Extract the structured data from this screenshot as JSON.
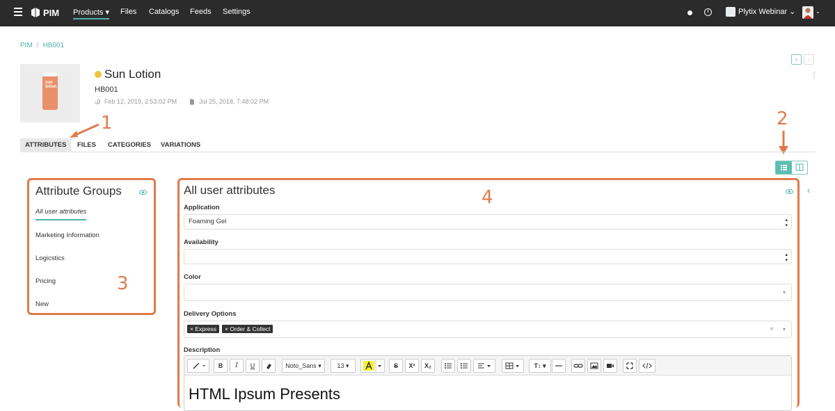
{
  "topbar": {
    "app_name": "PIM",
    "nav": [
      "Products",
      "Files",
      "Catalogs",
      "Feeds",
      "Settings"
    ],
    "products_caret": "▾",
    "account": "Plytix Webinar",
    "account_caret": "⌄",
    "avatar_caret": "⌄"
  },
  "breadcrumb": {
    "root": "PIM",
    "sep": "/",
    "current": "HB001"
  },
  "pager": {
    "prev": "‹",
    "next": "›"
  },
  "product": {
    "name": "Sun Lotion",
    "sku": "HB001",
    "modified": "Feb 12, 2019, 2:53:02 PM",
    "created": "Jul 25, 2018, 7:48:02 PM",
    "status_color": "#f3c13a",
    "image_label": "sun lotion"
  },
  "annotations": {
    "a1": "1",
    "a2": "2",
    "a3": "3",
    "a4": "4"
  },
  "tabs": [
    "ATTRIBUTES",
    "FILES",
    "CATEGORIES",
    "VARIATIONS"
  ],
  "groups": {
    "title": "Attribute Groups",
    "items": [
      "All user attributes",
      "Marketing Information",
      "Logicstics",
      "Pricing",
      "New"
    ]
  },
  "attributes": {
    "title": "All user attributes",
    "fields": {
      "application": {
        "label": "Application",
        "value": "Foaming Gel"
      },
      "availability": {
        "label": "Availability",
        "value": ""
      },
      "color": {
        "label": "Color",
        "value": ""
      },
      "delivery": {
        "label": "Delivery Options",
        "tags": [
          "Express",
          "Order & Collect"
        ]
      },
      "description": {
        "label": "Description",
        "content": "HTML Ipsum Presents"
      }
    }
  },
  "editor_toolbar": {
    "font": "Noto_Sans",
    "size": "13",
    "bold": "B",
    "italic": "I",
    "underline": "U",
    "strike": "S",
    "sup": "X²",
    "sub": "X₂",
    "text_size": "T↕"
  },
  "colors": {
    "accent": "#4fb3a9",
    "annotation": "#e07a4a",
    "topbar": "#2b2b2b"
  }
}
